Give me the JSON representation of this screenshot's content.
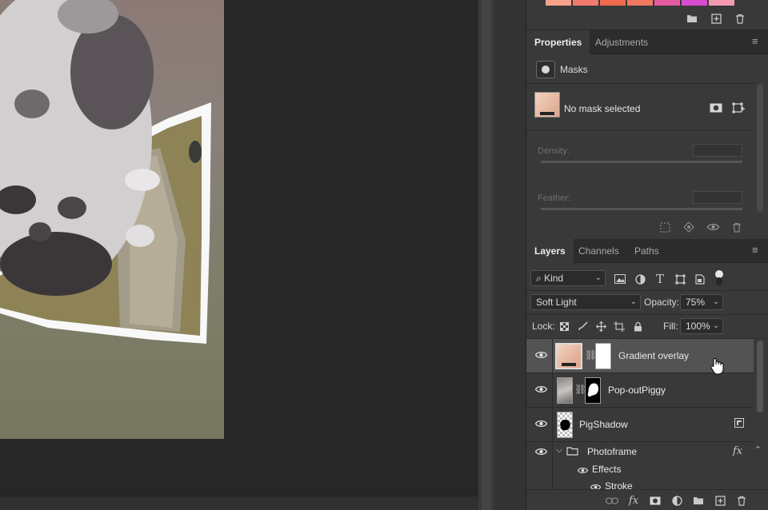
{
  "swatch_colors": [
    "#f6a38a",
    "#f27a6c",
    "#ef6a4c",
    "#f07860",
    "#e65aa2",
    "#d84ad0",
    "#f49ab0"
  ],
  "properties_panel": {
    "tabs": [
      "Properties",
      "Adjustments"
    ],
    "active_tab": "Properties",
    "section_label": "Masks",
    "status_text": "No mask selected",
    "density_label": "Density:",
    "feather_label": "Feather:"
  },
  "layers_panel": {
    "tabs": [
      "Layers",
      "Channels",
      "Paths"
    ],
    "active_tab": "Layers",
    "filter_kind": "Kind",
    "blend_mode": "Soft Light",
    "opacity_label": "Opacity:",
    "opacity_value": "75%",
    "lock_label": "Lock:",
    "fill_label": "Fill:",
    "fill_value": "100%",
    "layers": [
      {
        "name": "Gradient overlay",
        "selected": true,
        "visible": true,
        "has_mask": true
      },
      {
        "name": "Pop-outPiggy",
        "selected": false,
        "visible": true,
        "has_mask": true
      },
      {
        "name": "PigShadow",
        "selected": false,
        "visible": true,
        "has_mask": false
      },
      {
        "name": "Photoframe",
        "selected": false,
        "visible": true,
        "is_group": true,
        "fx_icon": "fx"
      },
      {
        "name": "Effects",
        "visible": true
      },
      {
        "name": "Stroke",
        "visible": true
      }
    ]
  },
  "icons": {
    "eye": "eye-icon",
    "folder": "folder-icon",
    "new_layer": "new-layer-icon",
    "trash": "trash-icon",
    "chain": "chain-link-icon",
    "hand_cursor": "hand-pointer-icon"
  },
  "accent_colors": {
    "panel_bg": "#393939",
    "selected_row": "#535353",
    "canvas_bg": "#272727"
  }
}
